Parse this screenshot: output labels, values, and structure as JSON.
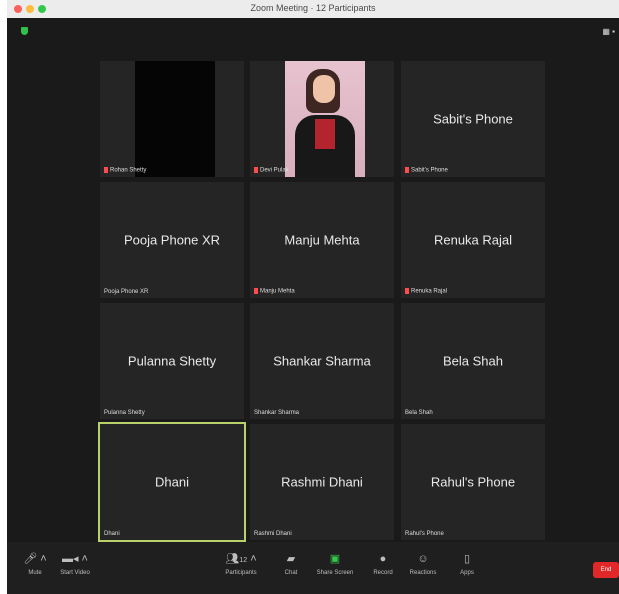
{
  "window": {
    "title": "Zoom Meeting · 12 Participants"
  },
  "header": {
    "view_label": "▦ ▪"
  },
  "participants": [
    {
      "display": "",
      "tag": "Rohan Shetty",
      "muted": true
    },
    {
      "display": "",
      "tag": "Devi Pulak",
      "muted": true
    },
    {
      "display": "Sabit's Phone",
      "tag": "Sabit's Phone",
      "muted": true
    },
    {
      "display": "Pooja Phone XR",
      "tag": "Pooja Phone XR",
      "muted": false
    },
    {
      "display": "Manju Mehta",
      "tag": "Manju Mehta",
      "muted": true
    },
    {
      "display": "Renuka Rajal",
      "tag": "Renuka Rajal",
      "muted": true
    },
    {
      "display": "Pulanna Shetty",
      "tag": "Pulanna Shetty",
      "muted": false
    },
    {
      "display": "Shankar Sharma",
      "tag": "Shankar Sharma",
      "muted": false
    },
    {
      "display": "Bela Shah",
      "tag": "Bela Shah",
      "muted": false
    },
    {
      "display": "Dhani",
      "tag": "Dhani",
      "muted": false
    },
    {
      "display": "Rashmi Dhani",
      "tag": "Rashmi Dhani",
      "muted": false
    },
    {
      "display": "Rahul's Phone",
      "tag": "Rahul's Phone",
      "muted": false
    }
  ],
  "controls": {
    "mute": "Mute",
    "video": "Start Video",
    "participants": "Participants",
    "participants_count": "12",
    "chat": "Chat",
    "share": "Share Screen",
    "record": "Record",
    "reactions": "Reactions",
    "apps": "Apps",
    "end": "End"
  }
}
